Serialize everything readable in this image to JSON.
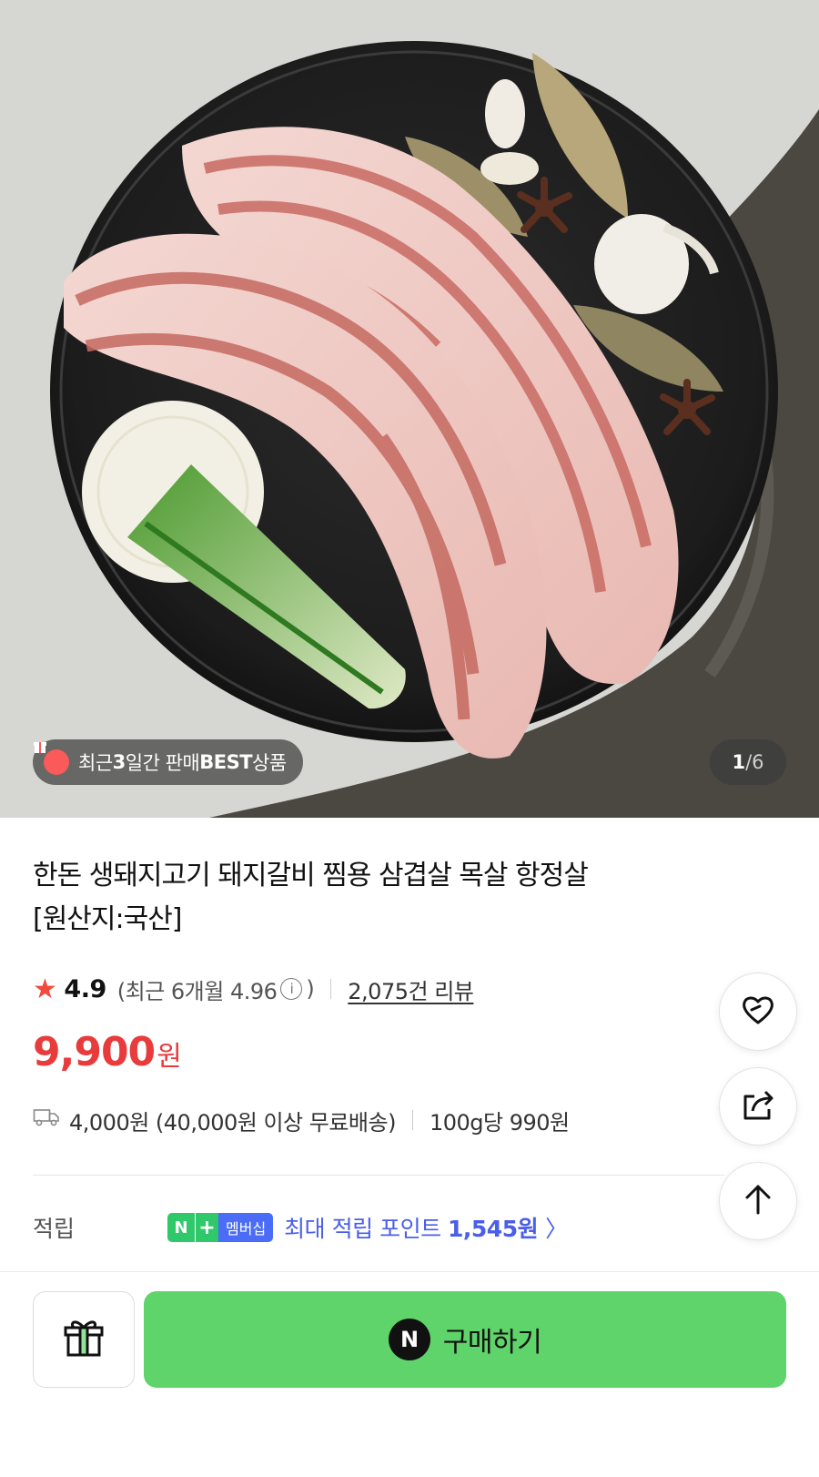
{
  "hero": {
    "badge_prefix": "최근 ",
    "badge_days": "3",
    "badge_mid": "일간 판매 ",
    "badge_best": "BEST",
    "badge_suffix": " 상품",
    "counter_current": "1",
    "counter_sep": "/",
    "counter_total": "6"
  },
  "product": {
    "title_line1": "한돈 생돼지고기 돼지갈비 찜용 삼겹살 목살 항정살",
    "title_line2": "[원산지:국산]",
    "rating": "4.9",
    "recent_rating_prefix": "(최근 6개월 4.96",
    "recent_rating_suffix": ")",
    "review_count": "2,075건 리뷰",
    "price": "9,900",
    "price_unit": "원",
    "shipping": "4,000원 (40,000원 이상 무료배송)",
    "unit_price": "100g당 990원"
  },
  "points": {
    "label": "적립",
    "n_badge": "N",
    "plus_badge": "+",
    "membership_badge": "멤버십",
    "text": "최대 적립 포인트 ",
    "amount": "1,545원",
    "chevron": "〉"
  },
  "actions": {
    "buy_label": "구매하기",
    "buy_logo": "N"
  },
  "colors": {
    "price": "#e83b3b",
    "buy_button": "#5fd46a",
    "points_text": "#4a5ee8",
    "star": "#f04b3c",
    "npay_green": "#2fc86a"
  },
  "icons": [
    "gift-icon",
    "star-icon",
    "info-icon",
    "truck-icon",
    "heart-icon",
    "share-icon",
    "arrow-up-icon",
    "present-icon"
  ]
}
